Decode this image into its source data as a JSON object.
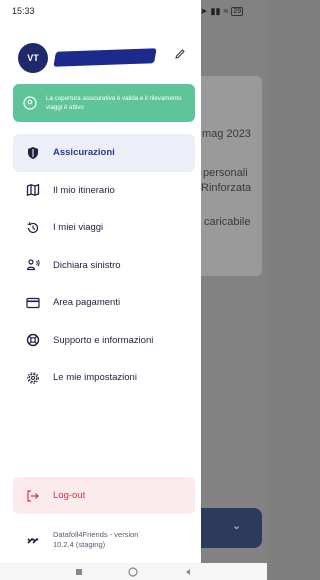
{
  "status_bar": {
    "time": "15:33",
    "battery": "29"
  },
  "user": {
    "initials": "VT"
  },
  "banner": {
    "text": "La copertura assicurativa è valida e il rilevamento viaggi è attivo"
  },
  "menu": {
    "items": [
      {
        "label": "Assicurazioni",
        "icon": "shield-icon",
        "active": true
      },
      {
        "label": "Il mio itinerario",
        "icon": "map-icon",
        "active": false
      },
      {
        "label": "I miei viaggi",
        "icon": "history-icon",
        "active": false
      },
      {
        "label": "Dichiara sinistro",
        "icon": "report-person-icon",
        "active": false
      },
      {
        "label": "Area pagamenti",
        "icon": "credit-card-icon",
        "active": false
      },
      {
        "label": "Supporto e informazioni",
        "icon": "lifebuoy-icon",
        "active": false
      },
      {
        "label": "Le mie impostazioni",
        "icon": "gear-icon",
        "active": false
      }
    ]
  },
  "logout": {
    "label": "Log-out"
  },
  "version": {
    "line1": "Datafoll4Friends - version",
    "line2": "10.2.4 (staging)"
  },
  "background": {
    "text1": "mag 2023",
    "text2": "personali",
    "text3": "Rinforzata",
    "text4": "caricabile"
  },
  "colors": {
    "banner": "#5fc49a",
    "active_bg": "#eceff8",
    "logout_bg": "#fcebec",
    "logout_text": "#d6364a",
    "avatar": "#1f2a6b"
  }
}
